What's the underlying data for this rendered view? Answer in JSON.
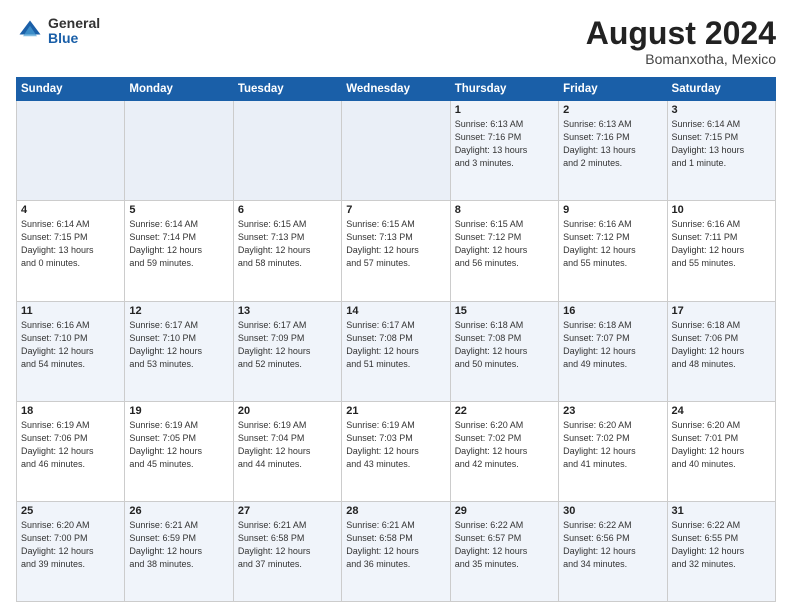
{
  "logo": {
    "general": "General",
    "blue": "Blue"
  },
  "title": "August 2024",
  "subtitle": "Bomanxotha, Mexico",
  "days_header": [
    "Sunday",
    "Monday",
    "Tuesday",
    "Wednesday",
    "Thursday",
    "Friday",
    "Saturday"
  ],
  "weeks": [
    {
      "cells": [
        {
          "day": "",
          "info": "",
          "empty": true
        },
        {
          "day": "",
          "info": "",
          "empty": true
        },
        {
          "day": "",
          "info": "",
          "empty": true
        },
        {
          "day": "",
          "info": "",
          "empty": true
        },
        {
          "day": "1",
          "info": "Sunrise: 6:13 AM\nSunset: 7:16 PM\nDaylight: 13 hours\nand 3 minutes."
        },
        {
          "day": "2",
          "info": "Sunrise: 6:13 AM\nSunset: 7:16 PM\nDaylight: 13 hours\nand 2 minutes."
        },
        {
          "day": "3",
          "info": "Sunrise: 6:14 AM\nSunset: 7:15 PM\nDaylight: 13 hours\nand 1 minute."
        }
      ]
    },
    {
      "cells": [
        {
          "day": "4",
          "info": "Sunrise: 6:14 AM\nSunset: 7:15 PM\nDaylight: 13 hours\nand 0 minutes."
        },
        {
          "day": "5",
          "info": "Sunrise: 6:14 AM\nSunset: 7:14 PM\nDaylight: 12 hours\nand 59 minutes."
        },
        {
          "day": "6",
          "info": "Sunrise: 6:15 AM\nSunset: 7:13 PM\nDaylight: 12 hours\nand 58 minutes."
        },
        {
          "day": "7",
          "info": "Sunrise: 6:15 AM\nSunset: 7:13 PM\nDaylight: 12 hours\nand 57 minutes."
        },
        {
          "day": "8",
          "info": "Sunrise: 6:15 AM\nSunset: 7:12 PM\nDaylight: 12 hours\nand 56 minutes."
        },
        {
          "day": "9",
          "info": "Sunrise: 6:16 AM\nSunset: 7:12 PM\nDaylight: 12 hours\nand 55 minutes."
        },
        {
          "day": "10",
          "info": "Sunrise: 6:16 AM\nSunset: 7:11 PM\nDaylight: 12 hours\nand 55 minutes."
        }
      ]
    },
    {
      "cells": [
        {
          "day": "11",
          "info": "Sunrise: 6:16 AM\nSunset: 7:10 PM\nDaylight: 12 hours\nand 54 minutes."
        },
        {
          "day": "12",
          "info": "Sunrise: 6:17 AM\nSunset: 7:10 PM\nDaylight: 12 hours\nand 53 minutes."
        },
        {
          "day": "13",
          "info": "Sunrise: 6:17 AM\nSunset: 7:09 PM\nDaylight: 12 hours\nand 52 minutes."
        },
        {
          "day": "14",
          "info": "Sunrise: 6:17 AM\nSunset: 7:08 PM\nDaylight: 12 hours\nand 51 minutes."
        },
        {
          "day": "15",
          "info": "Sunrise: 6:18 AM\nSunset: 7:08 PM\nDaylight: 12 hours\nand 50 minutes."
        },
        {
          "day": "16",
          "info": "Sunrise: 6:18 AM\nSunset: 7:07 PM\nDaylight: 12 hours\nand 49 minutes."
        },
        {
          "day": "17",
          "info": "Sunrise: 6:18 AM\nSunset: 7:06 PM\nDaylight: 12 hours\nand 48 minutes."
        }
      ]
    },
    {
      "cells": [
        {
          "day": "18",
          "info": "Sunrise: 6:19 AM\nSunset: 7:06 PM\nDaylight: 12 hours\nand 46 minutes."
        },
        {
          "day": "19",
          "info": "Sunrise: 6:19 AM\nSunset: 7:05 PM\nDaylight: 12 hours\nand 45 minutes."
        },
        {
          "day": "20",
          "info": "Sunrise: 6:19 AM\nSunset: 7:04 PM\nDaylight: 12 hours\nand 44 minutes."
        },
        {
          "day": "21",
          "info": "Sunrise: 6:19 AM\nSunset: 7:03 PM\nDaylight: 12 hours\nand 43 minutes."
        },
        {
          "day": "22",
          "info": "Sunrise: 6:20 AM\nSunset: 7:02 PM\nDaylight: 12 hours\nand 42 minutes."
        },
        {
          "day": "23",
          "info": "Sunrise: 6:20 AM\nSunset: 7:02 PM\nDaylight: 12 hours\nand 41 minutes."
        },
        {
          "day": "24",
          "info": "Sunrise: 6:20 AM\nSunset: 7:01 PM\nDaylight: 12 hours\nand 40 minutes."
        }
      ]
    },
    {
      "cells": [
        {
          "day": "25",
          "info": "Sunrise: 6:20 AM\nSunset: 7:00 PM\nDaylight: 12 hours\nand 39 minutes."
        },
        {
          "day": "26",
          "info": "Sunrise: 6:21 AM\nSunset: 6:59 PM\nDaylight: 12 hours\nand 38 minutes."
        },
        {
          "day": "27",
          "info": "Sunrise: 6:21 AM\nSunset: 6:58 PM\nDaylight: 12 hours\nand 37 minutes."
        },
        {
          "day": "28",
          "info": "Sunrise: 6:21 AM\nSunset: 6:58 PM\nDaylight: 12 hours\nand 36 minutes."
        },
        {
          "day": "29",
          "info": "Sunrise: 6:22 AM\nSunset: 6:57 PM\nDaylight: 12 hours\nand 35 minutes."
        },
        {
          "day": "30",
          "info": "Sunrise: 6:22 AM\nSunset: 6:56 PM\nDaylight: 12 hours\nand 34 minutes."
        },
        {
          "day": "31",
          "info": "Sunrise: 6:22 AM\nSunset: 6:55 PM\nDaylight: 12 hours\nand 32 minutes."
        }
      ]
    }
  ]
}
